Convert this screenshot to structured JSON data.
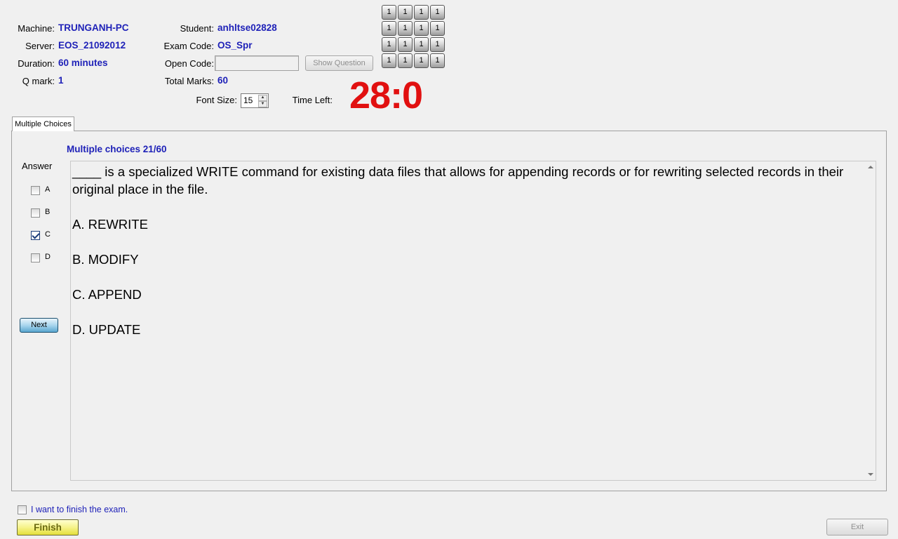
{
  "info": {
    "machine_label": "Machine:",
    "machine_value": "TRUNGANH-PC",
    "server_label": "Server:",
    "server_value": "EOS_21092012",
    "duration_label": "Duration:",
    "duration_value": "60 minutes",
    "qmark_label": "Q mark:",
    "qmark_value": "1",
    "student_label": "Student:",
    "student_value": "anhltse02828",
    "exam_code_label": "Exam Code:",
    "exam_code_value": "OS_Spr",
    "open_code_label": "Open Code:",
    "open_code_value": "",
    "total_marks_label": "Total Marks:",
    "total_marks_value": "60"
  },
  "show_question_label": "Show Question",
  "question_grid": {
    "rows": [
      [
        "1",
        "1",
        "1",
        "1"
      ],
      [
        "1",
        "1",
        "1",
        "1"
      ],
      [
        "1",
        "1",
        "1",
        "1"
      ],
      [
        "1",
        "1",
        "1",
        "1"
      ]
    ]
  },
  "font_size": {
    "label": "Font Size:",
    "value": "15"
  },
  "time_left": {
    "label": "Time Left:",
    "value": "28:0"
  },
  "tab": {
    "label": "Multiple Choices"
  },
  "question": {
    "header": "Multiple choices 21/60",
    "text": "____ is a specialized WRITE command for existing data files that allows for appending records or for rewriting selected records in their original place in the file.",
    "options": [
      "A.  REWRITE",
      "B.  MODIFY",
      "C.  APPEND",
      "D.  UPDATE"
    ]
  },
  "answer": {
    "label": "Answer",
    "choices": [
      {
        "letter": "A",
        "checked": false
      },
      {
        "letter": "B",
        "checked": false
      },
      {
        "letter": "C",
        "checked": true
      },
      {
        "letter": "D",
        "checked": false
      }
    ]
  },
  "next_label": "Next",
  "finish": {
    "confirm_text": "I want to finish the exam.",
    "button_label": "Finish"
  },
  "exit_label": "Exit"
}
